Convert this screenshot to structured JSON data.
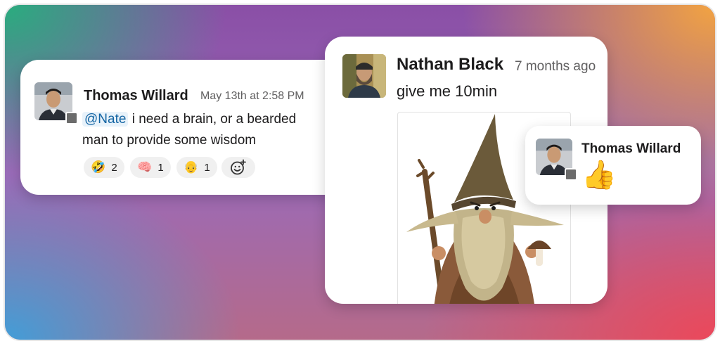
{
  "colors": {
    "mention_text": "#1264a3",
    "mention_bg": "#e8f2fa",
    "status_gray": "#6b6b6b"
  },
  "card_left": {
    "author": "Thomas Willard",
    "timestamp": "May 13th at 2:58 PM",
    "mention": "@Nate",
    "text_line1": " i need a brain, or a bearded",
    "text_line2": "man to provide some wisdom",
    "reactions": [
      {
        "emoji": "🤣",
        "icon": "rofl-emoji-icon",
        "count": "2"
      },
      {
        "emoji": "🧠",
        "icon": "brain-emoji-icon",
        "count": "1"
      },
      {
        "emoji": "👴",
        "icon": "old-man-emoji-icon",
        "count": "1"
      }
    ]
  },
  "card_center": {
    "author": "Nathan Black",
    "timestamp": "7 months ago",
    "text": "give me 10min"
  },
  "card_right": {
    "author": "Thomas Willard",
    "emoji": "👍"
  }
}
